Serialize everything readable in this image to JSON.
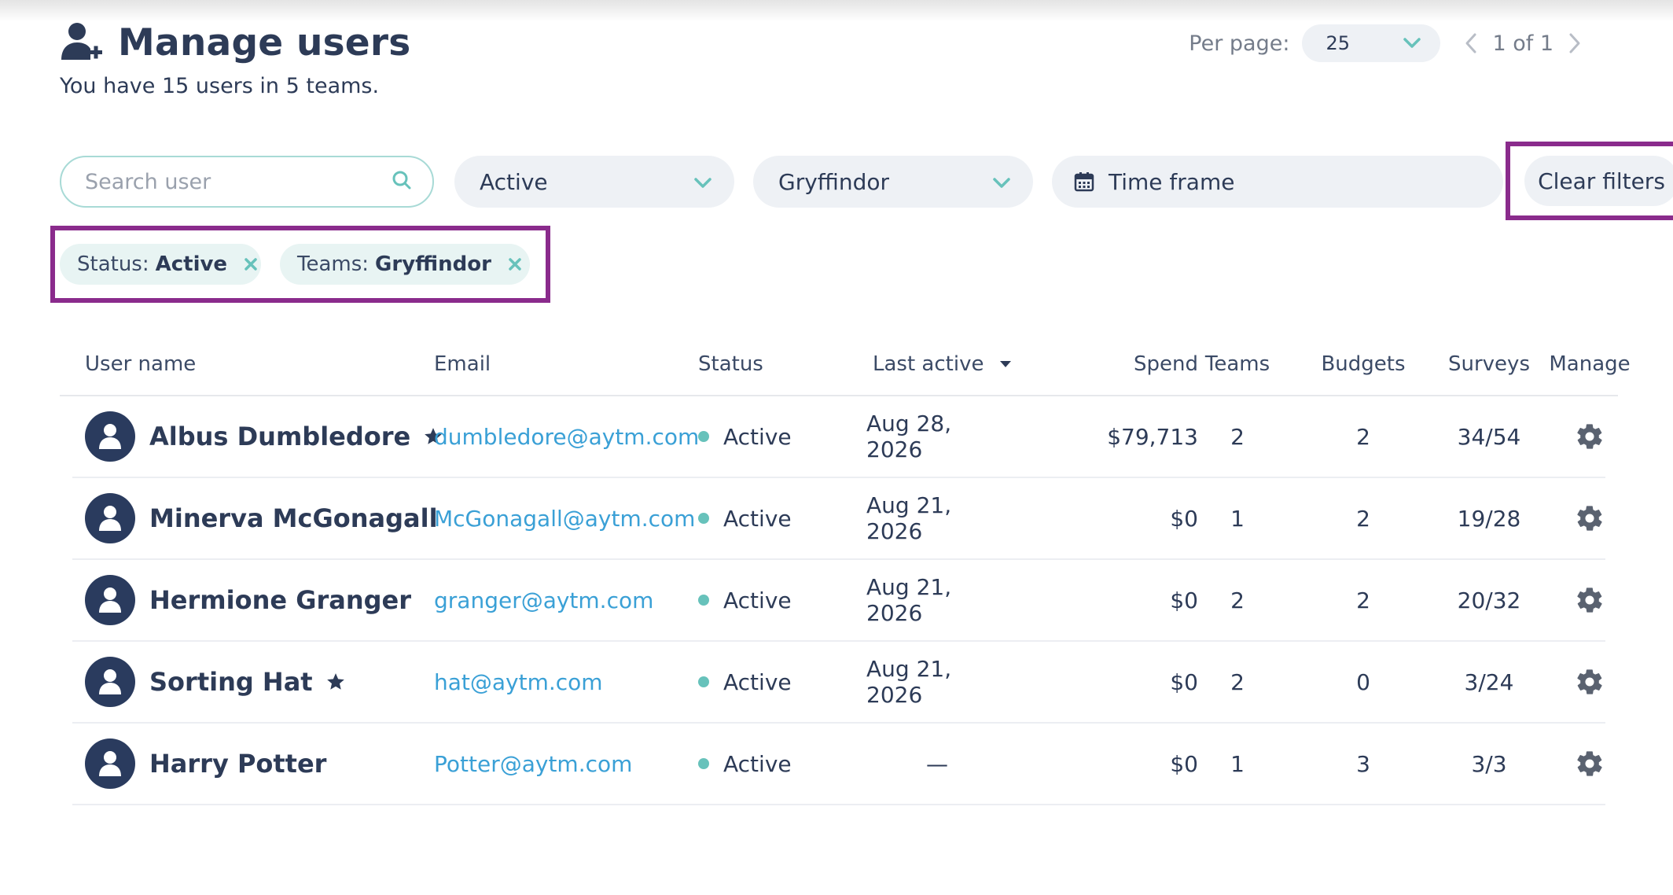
{
  "header": {
    "title": "Manage users",
    "subtitle": "You have 15 users in 5 teams.",
    "title_icon": "user-add-icon"
  },
  "pagination": {
    "per_page_label": "Per page:",
    "per_page_value": "25",
    "page_text": "1 of 1"
  },
  "filters": {
    "search_placeholder": "Search user",
    "status_value": "Active",
    "team_value": "Gryffindor",
    "timeframe_label": "Time frame",
    "clear_label": "Clear filters"
  },
  "active_filters": [
    {
      "key": "Status:",
      "value": "Active"
    },
    {
      "key": "Teams:",
      "value": "Gryffindor"
    }
  ],
  "table": {
    "columns": [
      "User name",
      "Email",
      "Status",
      "Last active",
      "Spend",
      "Teams",
      "Budgets",
      "Surveys",
      "Manage"
    ],
    "sorted_column": "Last active",
    "rows": [
      {
        "name": "Albus Dumbledore",
        "starred": true,
        "email": "dumbledore@aytm.com",
        "status": "Active",
        "last_active": "Aug 28, 2026",
        "spend": "$79,713",
        "teams": "2",
        "budgets": "2",
        "surveys": "34/54"
      },
      {
        "name": "Minerva McGonagall",
        "starred": false,
        "email": "McGonagall@aytm.com",
        "status": "Active",
        "last_active": "Aug 21, 2026",
        "spend": "$0",
        "teams": "1",
        "budgets": "2",
        "surveys": "19/28"
      },
      {
        "name": "Hermione Granger",
        "starred": false,
        "email": "granger@aytm.com",
        "status": "Active",
        "last_active": "Aug 21, 2026",
        "spend": "$0",
        "teams": "2",
        "budgets": "2",
        "surveys": "20/32"
      },
      {
        "name": "Sorting Hat",
        "starred": true,
        "email": "hat@aytm.com",
        "status": "Active",
        "last_active": "Aug 21, 2026",
        "spend": "$0",
        "teams": "2",
        "budgets": "0",
        "surveys": "3/24"
      },
      {
        "name": "Harry Potter",
        "starred": false,
        "email": "Potter@aytm.com",
        "status": "Active",
        "last_active": "—",
        "spend": "$0",
        "teams": "1",
        "budgets": "3",
        "surveys": "3/3"
      }
    ]
  },
  "colors": {
    "primary_text": "#2d3b57",
    "accent_teal": "#67c2bb",
    "link_blue": "#3aa0d6",
    "highlight_purple": "#8a2b8c",
    "pill_bg": "#eef1f5"
  }
}
